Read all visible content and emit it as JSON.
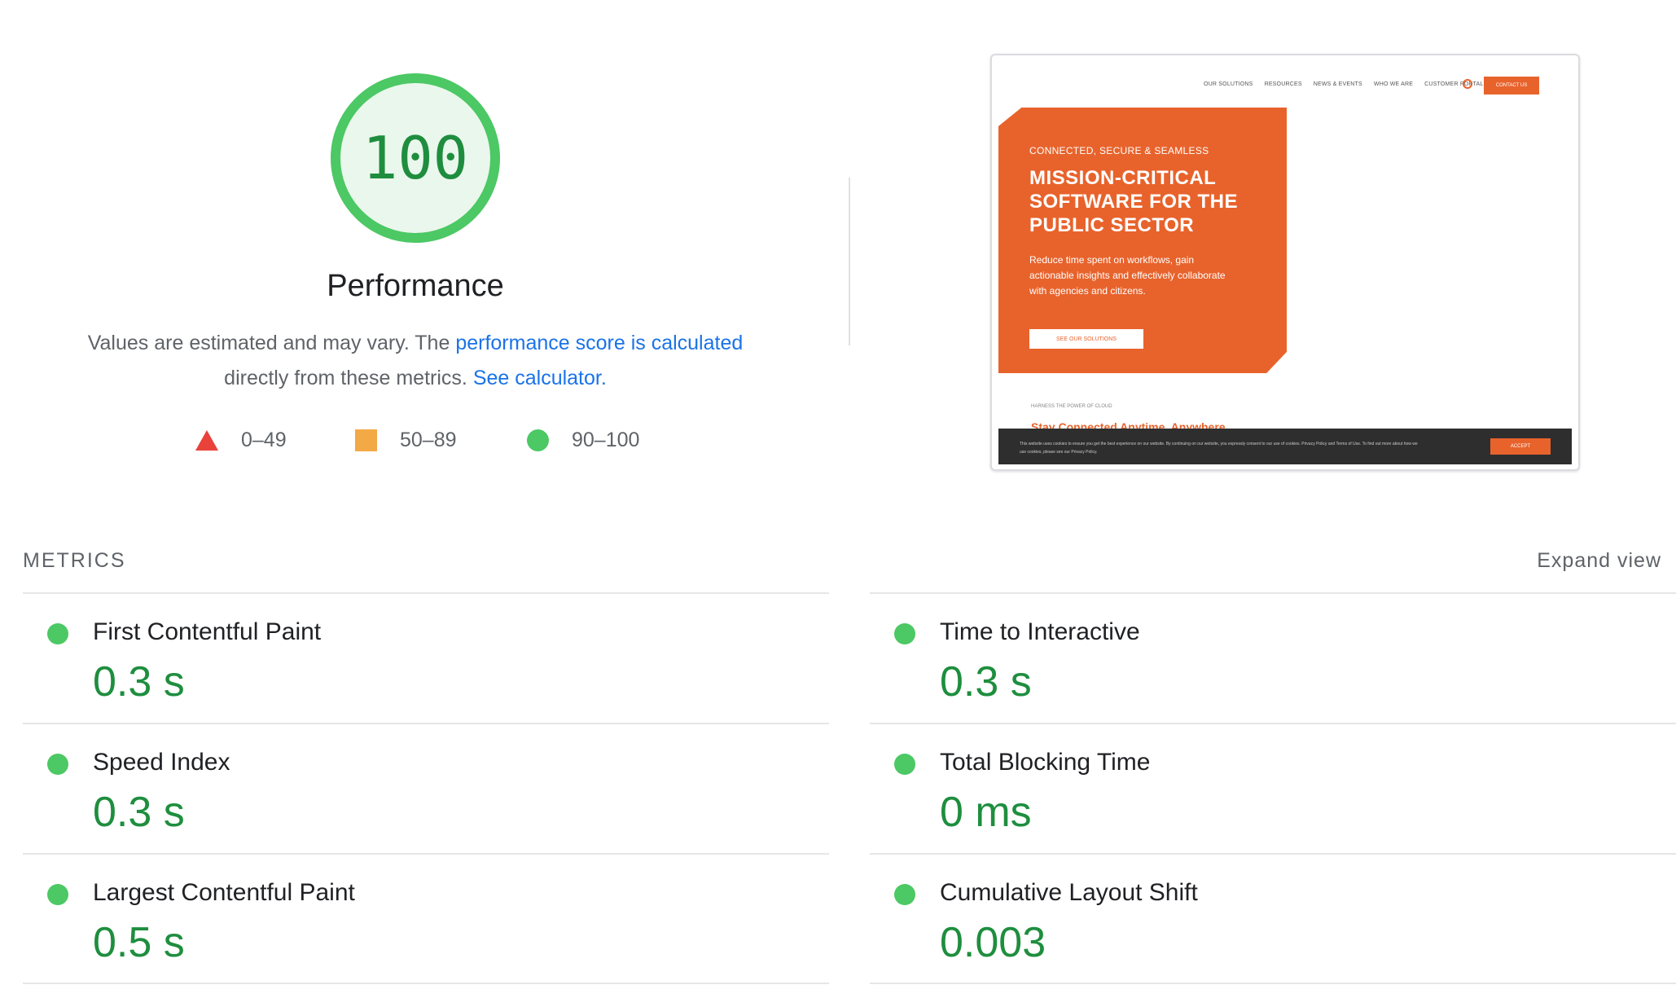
{
  "score": {
    "value": "100",
    "title": "Performance",
    "ring_color": "#4cc864",
    "fill_color": "#eaf7ec",
    "text_color": "#1e8e3e",
    "fraction": 1.0
  },
  "description": {
    "prefix": "Values are estimated and may vary. The ",
    "link1": "performance score is calculated",
    "middle": " directly from these metrics. ",
    "link2": "See calculator."
  },
  "legend": [
    {
      "icon": "red-triangle-icon",
      "label": "0–49",
      "color": "#e8423a"
    },
    {
      "icon": "orange-square-icon",
      "label": "50–89",
      "color": "#f4a947"
    },
    {
      "icon": "green-circle-icon",
      "label": "90–100",
      "color": "#4cc864"
    }
  ],
  "thumbnail": {
    "nav": [
      "OUR SOLUTIONS",
      "RESOURCES",
      "NEWS & EVENTS",
      "WHO WE ARE",
      "CUSTOMER PORTAL"
    ],
    "contact": "CONTACT US",
    "eyebrow": "CONNECTED, SECURE & SEAMLESS",
    "title": "MISSION-CRITICAL SOFTWARE FOR THE PUBLIC SECTOR",
    "body": "Reduce time spent on workflows, gain actionable insights and effectively collaborate with agencies and citizens.",
    "button": "SEE OUR SOLUTIONS",
    "sub_eyebrow": "HARNESS THE POWER OF CLOUD",
    "sub_title": "Stay Connected Anytime, Anywhere",
    "cookie_text": "This website uses cookies to ensure you get the best experience on our website. By continuing on our website, you expressly consent to our use of cookies. Privacy Policy and Terms of Use. To find out more about how we use cookies, please see our Privacy Policy.",
    "accept": "ACCEPT",
    "accent": "#e8632c"
  },
  "metrics": {
    "header": "METRICS",
    "expand": "Expand view",
    "items": [
      {
        "label": "First Contentful Paint",
        "value": "0.3 s"
      },
      {
        "label": "Time to Interactive",
        "value": "0.3 s"
      },
      {
        "label": "Speed Index",
        "value": "0.3 s"
      },
      {
        "label": "Total Blocking Time",
        "value": "0 ms"
      },
      {
        "label": "Largest Contentful Paint",
        "value": "0.5 s"
      },
      {
        "label": "Cumulative Layout Shift",
        "value": "0.003"
      }
    ]
  }
}
